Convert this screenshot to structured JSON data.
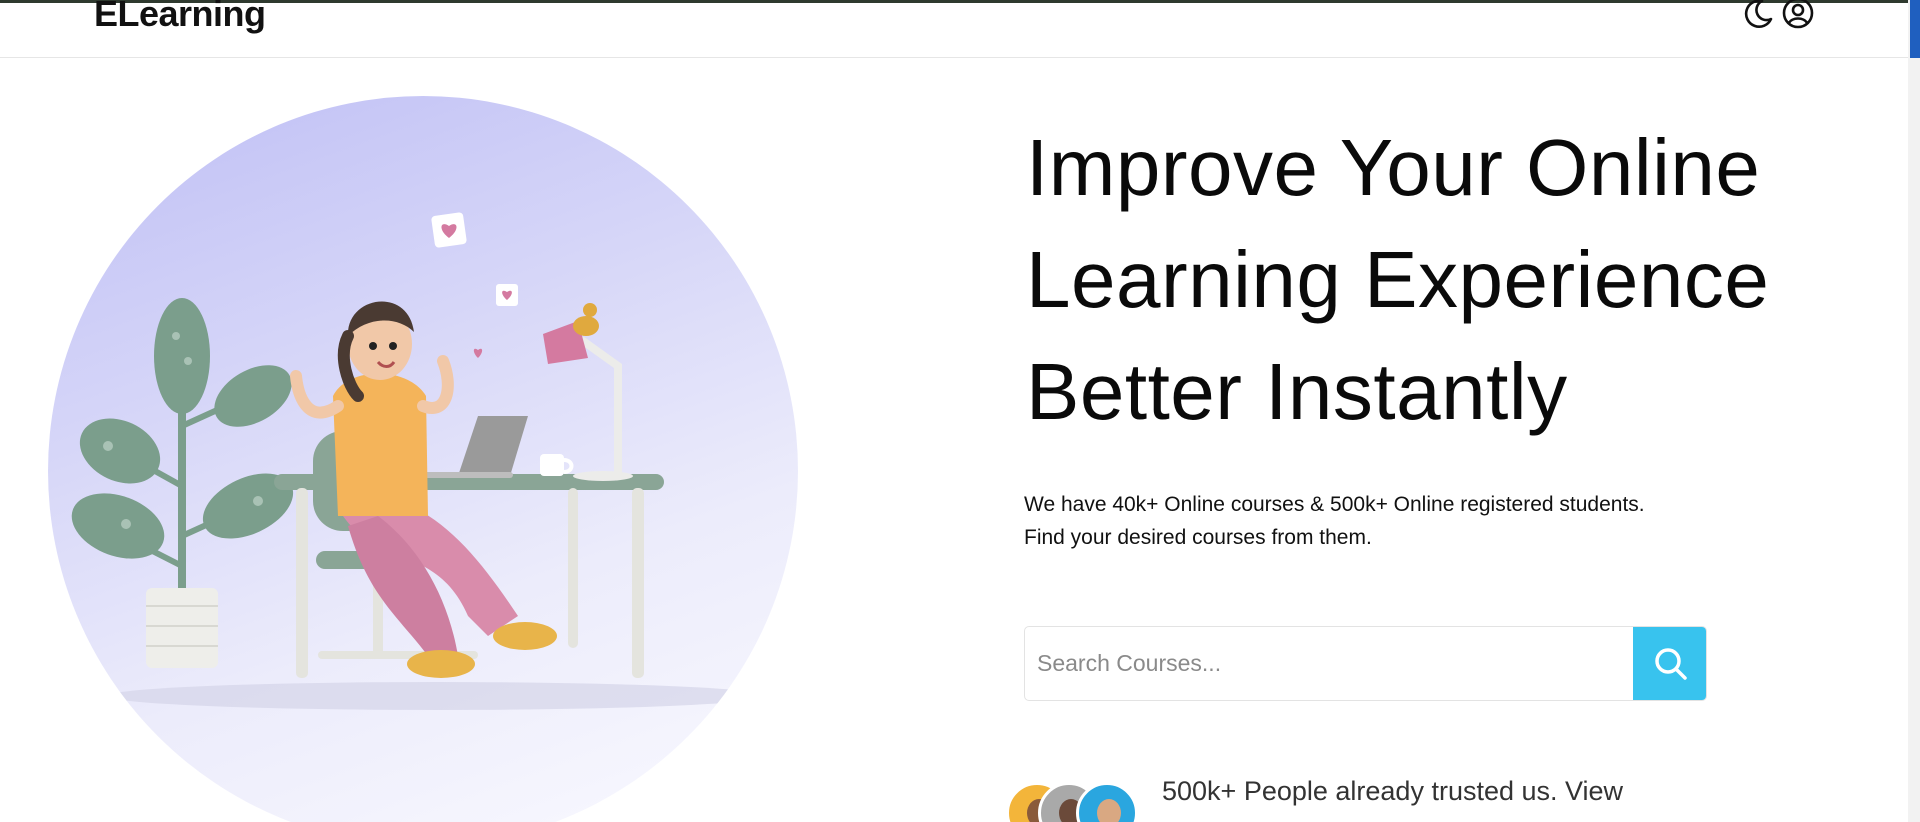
{
  "navbar": {
    "brand": "ELearning",
    "icons": [
      "moon-icon",
      "user-circle-icon"
    ]
  },
  "hero": {
    "title_lines": [
      "Improve Your Online",
      "Learning Experience",
      "Better Instantly"
    ],
    "subtitle": "We have 40k+ Online courses & 500k+ Online registered students. Find your desired courses from them.",
    "illustration": "girl-studying-at-desk-illustration"
  },
  "search": {
    "placeholder": "Search Courses...",
    "value": "",
    "button_icon": "search-icon"
  },
  "trust": {
    "text": "500k+ People already trusted us. View",
    "avatars": [
      "avatar-1",
      "avatar-2",
      "avatar-3"
    ]
  },
  "colors": {
    "accent": "#38c3ee",
    "circle_top": "#bfbff5",
    "circle_bottom": "#fafaff",
    "text": "#0a0a0a",
    "scrollbar_thumb": "#1f5fbf"
  }
}
